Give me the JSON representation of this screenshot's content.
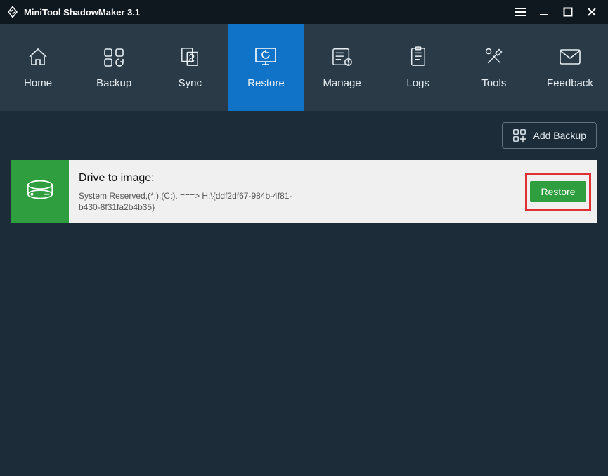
{
  "app": {
    "title": "MiniTool ShadowMaker 3.1"
  },
  "nav": {
    "items": [
      {
        "label": "Home"
      },
      {
        "label": "Backup"
      },
      {
        "label": "Sync"
      },
      {
        "label": "Restore"
      },
      {
        "label": "Manage"
      },
      {
        "label": "Logs"
      },
      {
        "label": "Tools"
      },
      {
        "label": "Feedback"
      }
    ]
  },
  "toolbar": {
    "add_backup_label": "Add Backup"
  },
  "card": {
    "title": "Drive to image:",
    "desc": "System Reserved,(*:).(C:). ===> H:\\{ddf2df67-984b-4f81-b430-8f31fa2b4b35}",
    "restore_label": "Restore"
  }
}
